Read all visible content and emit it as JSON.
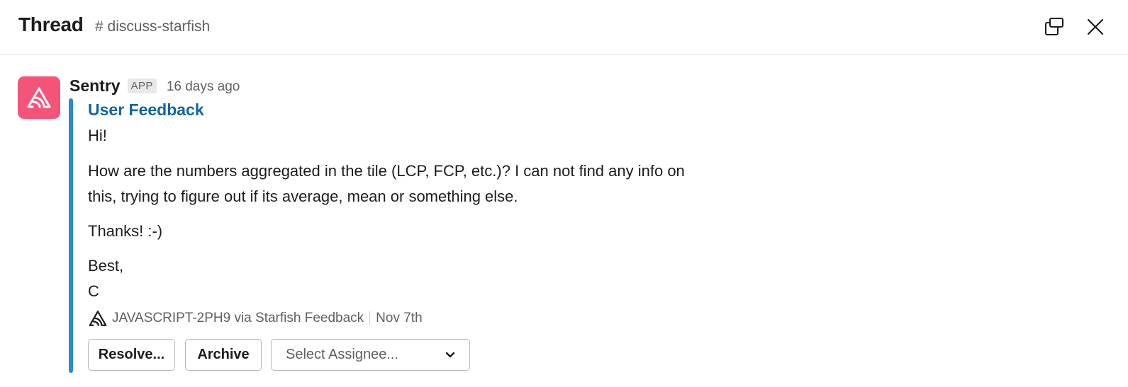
{
  "header": {
    "title": "Thread",
    "channel": "# discuss-starfish",
    "popout_icon": "popout-icon",
    "close_icon": "close-icon"
  },
  "message": {
    "sender": "Sentry",
    "badge": "APP",
    "timestamp": "16 days ago",
    "avatar_icon": "sentry-logo-icon",
    "avatar_color": "#f55479",
    "attachment": {
      "title": "User Feedback",
      "bar_color": "#2d87d1",
      "body": {
        "greeting": "Hi!",
        "line1": "How are the numbers aggregated in the tile (LCP, FCP, etc.)? I can not find any info on",
        "line2": "this, trying to figure out if its average, mean or something else.",
        "thanks": "Thanks! :-)",
        "signoff": "Best,",
        "signature_initial": "C"
      },
      "footer": {
        "issue": "JAVASCRIPT-2PH9 via Starfish Feedback",
        "date": "Nov 7th"
      },
      "actions": {
        "resolve": "Resolve...",
        "archive": "Archive",
        "assignee_placeholder": "Select Assignee..."
      }
    }
  }
}
